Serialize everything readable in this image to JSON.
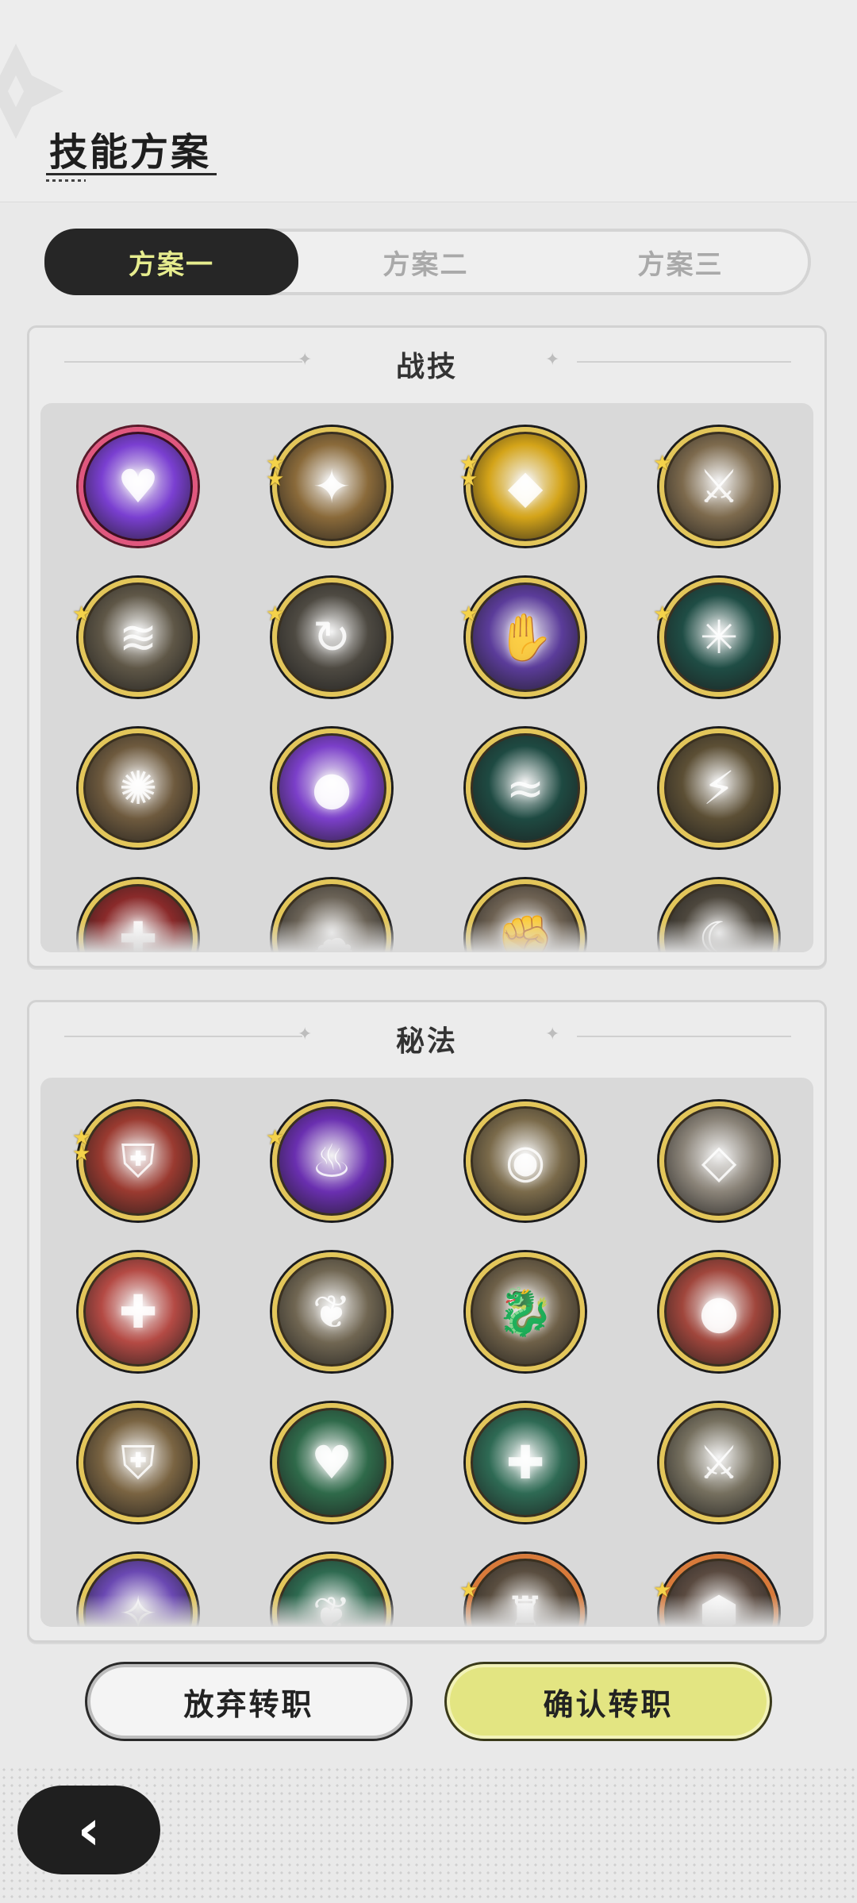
{
  "header": {
    "title": "技能方案"
  },
  "tabs": [
    {
      "label": "方案一",
      "active": true
    },
    {
      "label": "方案二",
      "active": false
    },
    {
      "label": "方案三",
      "active": false
    }
  ],
  "sections": {
    "combat": {
      "title": "战技"
    },
    "arcane": {
      "title": "秘法"
    }
  },
  "combat_skills": [
    {
      "icon": "purple-heart-skill-icon",
      "color": "#7a3fd1",
      "stars": 0,
      "frame": "pink"
    },
    {
      "icon": "golden-swirl-skill-icon",
      "color": "#8a6a3a",
      "stars": 2,
      "frame": "gold"
    },
    {
      "icon": "golden-shield-skill-icon",
      "color": "#d4a419",
      "stars": 2,
      "frame": "gold"
    },
    {
      "icon": "sword-thrust-skill-icon",
      "color": "#7d6a4d",
      "stars": 1,
      "frame": "gold"
    },
    {
      "icon": "wind-slash-skill-icon",
      "color": "#5f5747",
      "stars": 1,
      "frame": "gold"
    },
    {
      "icon": "whirl-slash-skill-icon",
      "color": "#4e4a42",
      "stars": 1,
      "frame": "gold"
    },
    {
      "icon": "shadow-claw-skill-icon",
      "color": "#5b3c9a",
      "stars": 1,
      "frame": "gold"
    },
    {
      "icon": "spider-web-skill-icon",
      "color": "#1f4d45",
      "stars": 1,
      "frame": "gold"
    },
    {
      "icon": "burst-explosion-skill-icon",
      "color": "#6e5a3e",
      "stars": 0,
      "frame": "gold"
    },
    {
      "icon": "purple-fireball-skill-icon",
      "color": "#7b3fc9",
      "stars": 0,
      "frame": "gold"
    },
    {
      "icon": "teal-wave-skill-icon",
      "color": "#1e4a42",
      "stars": 0,
      "frame": "gold"
    },
    {
      "icon": "lightning-strike-skill-icon",
      "color": "#5c4f35",
      "stars": 0,
      "frame": "gold"
    },
    {
      "icon": "red-dagger-skill-icon",
      "color": "#8a2a2a",
      "stars": 0,
      "frame": "gold"
    },
    {
      "icon": "dust-cloud-skill-icon",
      "color": "#6a6256",
      "stars": 0,
      "frame": "gold"
    },
    {
      "icon": "claw-grab-skill-icon",
      "color": "#6e6253",
      "stars": 0,
      "frame": "gold"
    },
    {
      "icon": "crescent-slash-skill-icon",
      "color": "#4d473d",
      "stars": 0,
      "frame": "gold"
    }
  ],
  "arcane_skills": [
    {
      "icon": "red-armor-skill-icon",
      "color": "#9a3a30",
      "stars": 2,
      "frame": "gold"
    },
    {
      "icon": "purple-flame-skill-icon",
      "color": "#6a2fb0",
      "stars": 1,
      "frame": "gold"
    },
    {
      "icon": "all-seeing-eye-skill-icon",
      "color": "#7a6a4a",
      "stars": 0,
      "frame": "gold"
    },
    {
      "icon": "crystal-shard-skill-icon",
      "color": "#8a8378",
      "stars": 0,
      "frame": "gold"
    },
    {
      "icon": "red-sword-heal-skill-icon",
      "color": "#b44a44",
      "stars": 0,
      "frame": "gold"
    },
    {
      "icon": "leaf-crescent-skill-icon",
      "color": "#706652",
      "stars": 0,
      "frame": "gold"
    },
    {
      "icon": "dragon-skill-icon",
      "color": "#6e6048",
      "stars": 0,
      "frame": "gold"
    },
    {
      "icon": "red-boulder-skill-icon",
      "color": "#a0463c",
      "stars": 0,
      "frame": "gold"
    },
    {
      "icon": "gold-armor-skill-icon",
      "color": "#7a6442",
      "stars": 0,
      "frame": "gold"
    },
    {
      "icon": "green-heart-skill-icon",
      "color": "#2f6a4a",
      "stars": 0,
      "frame": "gold"
    },
    {
      "icon": "green-heal-pillar-skill-icon",
      "color": "#2e6a54",
      "stars": 0,
      "frame": "gold"
    },
    {
      "icon": "sword-buff-skill-icon",
      "color": "#76705f",
      "stars": 0,
      "frame": "gold"
    },
    {
      "icon": "violet-aura-skill-icon",
      "color": "#6a48b2",
      "stars": 0,
      "frame": "gold"
    },
    {
      "icon": "green-leaf-skill-icon",
      "color": "#2e6a50",
      "stars": 0,
      "frame": "gold"
    },
    {
      "icon": "helm-crest-skill-icon",
      "color": "#5a4e40",
      "stars": 1,
      "frame": "orange"
    },
    {
      "icon": "hex-shield-skill-icon",
      "color": "#5a4a40",
      "stars": 1,
      "frame": "orange"
    }
  ],
  "buttons": {
    "abandon": "放弃转职",
    "confirm": "确认转职",
    "back": "‹"
  },
  "colors": {
    "accent_tab_text": "#e6ec8e",
    "confirm_button": "#e3e582",
    "frame_gold": "#e3c65a"
  }
}
